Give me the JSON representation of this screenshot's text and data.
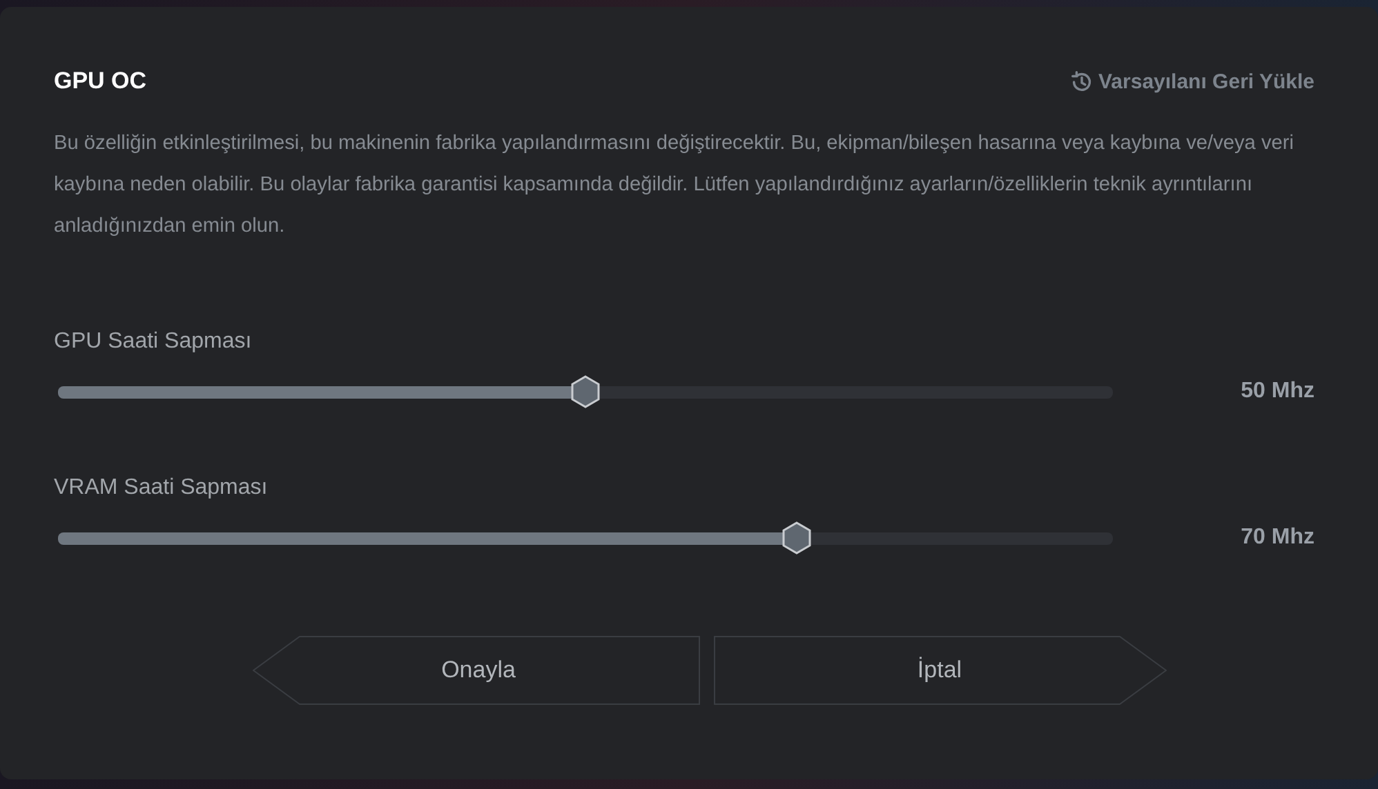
{
  "dialog": {
    "title": "GPU OC",
    "reset_link": "Varsayılanı Geri Yükle",
    "warning": "Bu özelliğin etkinleştirilmesi, bu makinenin fabrika yapılandırmasını değiştirecektir. Bu, ekipman/bileşen hasarına veya kaybına ve/veya veri kaybına neden olabilir. Bu olaylar fabrika garantisi kapsamında değildir. Lütfen yapılandırdığınız ayarların/özelliklerin teknik ayrıntılarını anladığınızdan emin olun.",
    "sliders": [
      {
        "label": "GPU Saati Sapması",
        "level": 0.5,
        "reading": "50 Mhz"
      },
      {
        "label": "VRAM Saati Sapması",
        "level": 0.7,
        "reading": "70 Mhz"
      }
    ],
    "buttons": [
      {
        "label": "Onayla",
        "kind": "left"
      },
      {
        "label": "İptal",
        "kind": "right"
      }
    ]
  }
}
